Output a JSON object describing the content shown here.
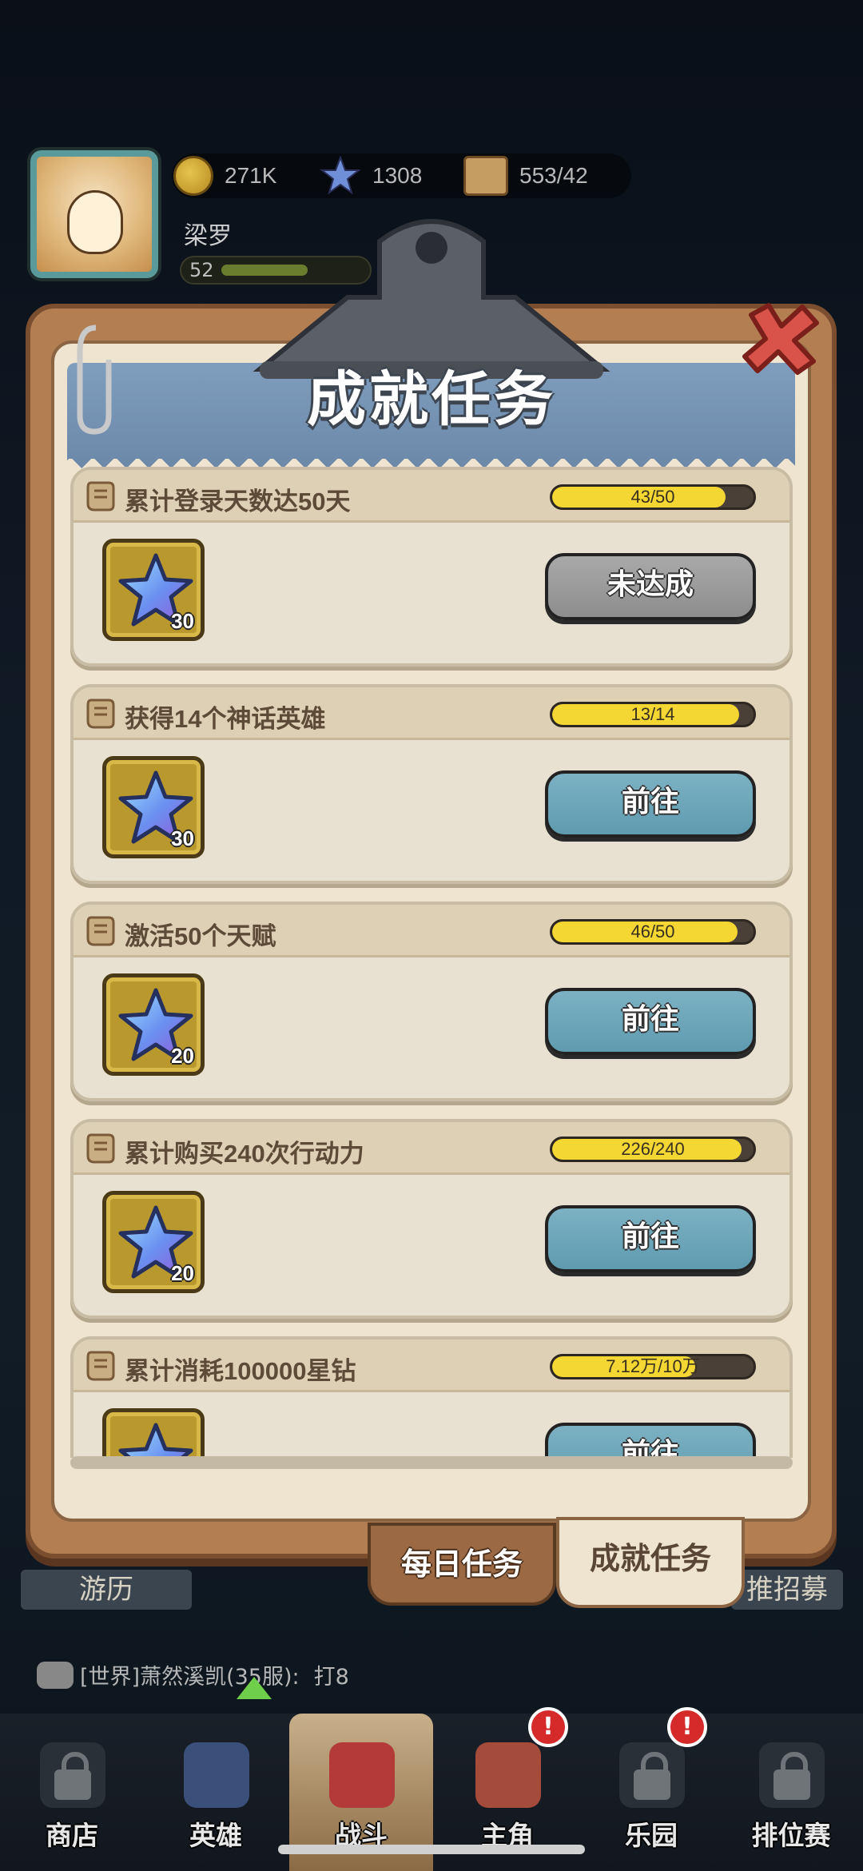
{
  "hud": {
    "player_name": "梁罗",
    "level": "52",
    "level_progress": 0.6,
    "coins": "271K",
    "stars": "1308",
    "stamina": "553/42"
  },
  "panel": {
    "title": "成就任务"
  },
  "tasks": [
    {
      "title": "累计登录天数达50天",
      "progress_text": "43/50",
      "progress": 0.86,
      "reward_count": "30",
      "button": "未达成",
      "button_style": "gray"
    },
    {
      "title": "获得14个神话英雄",
      "progress_text": "13/14",
      "progress": 0.93,
      "reward_count": "30",
      "button": "前往",
      "button_style": "blue"
    },
    {
      "title": "激活50个天赋",
      "progress_text": "46/50",
      "progress": 0.92,
      "reward_count": "20",
      "button": "前往",
      "button_style": "blue"
    },
    {
      "title": "累计购买240次行动力",
      "progress_text": "226/240",
      "progress": 0.94,
      "reward_count": "20",
      "button": "前往",
      "button_style": "blue"
    },
    {
      "title": "累计消耗100000星钻",
      "progress_text": "7.12万/10万",
      "progress": 0.71,
      "reward_count": "",
      "button": "前往",
      "button_style": "blue"
    }
  ],
  "tabs": {
    "daily": "每日任务",
    "achievement": "成就任务"
  },
  "side_labels": {
    "left": "游历",
    "right": "推招募"
  },
  "chat": {
    "channel": "[世界]萧然溪凯(35服):",
    "message": "打8"
  },
  "nav": [
    {
      "label": "商店",
      "locked": true
    },
    {
      "label": "英雄",
      "locked": false
    },
    {
      "label": "战斗",
      "locked": false
    },
    {
      "label": "主角",
      "locked": false
    },
    {
      "label": "乐园",
      "locked": true
    },
    {
      "label": "排位赛",
      "locked": true
    }
  ],
  "colors": {
    "progress_fill": "#f4d733",
    "button_blue": "#6aa5b9",
    "button_gray": "#9b9b9b",
    "board": "#b27e52"
  }
}
